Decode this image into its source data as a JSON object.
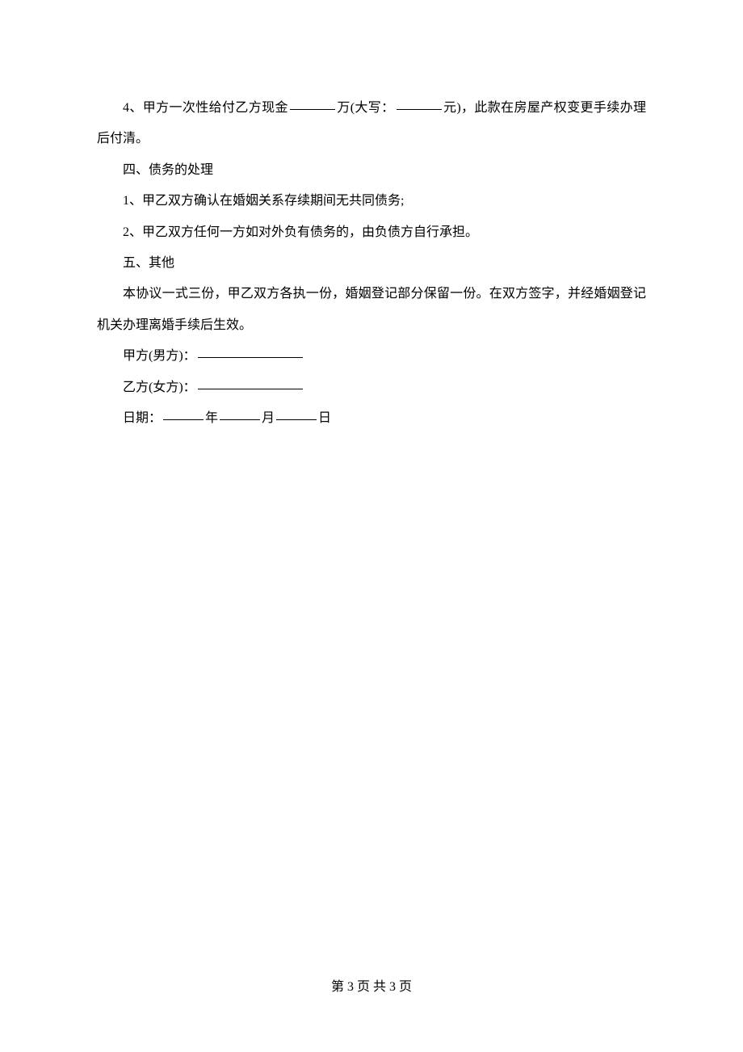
{
  "paragraphs": {
    "p1_a": "4、甲方一次性给付乙方现金",
    "p1_b": "万(大写：",
    "p1_c": "元)，此款在房屋产权变更手续办理后付清。",
    "p2": "四、债务的处理",
    "p3": "1、甲乙双方确认在婚姻关系存续期间无共同债务;",
    "p4": "2、甲乙双方任何一方如对外负有债务的，由负债方自行承担。",
    "p5": "五、其他",
    "p6": "本协议一式三份，甲乙双方各执一份，婚姻登记部分保留一份。在双方签字，并经婚姻登记机关办理离婚手续后生效。",
    "p7": "甲方(男方)：",
    "p8": "乙方(女方)：",
    "p9_a": "日期：",
    "p9_b": "年",
    "p9_c": "月",
    "p9_d": "日"
  },
  "footer": "第 3 页  共  3 页"
}
